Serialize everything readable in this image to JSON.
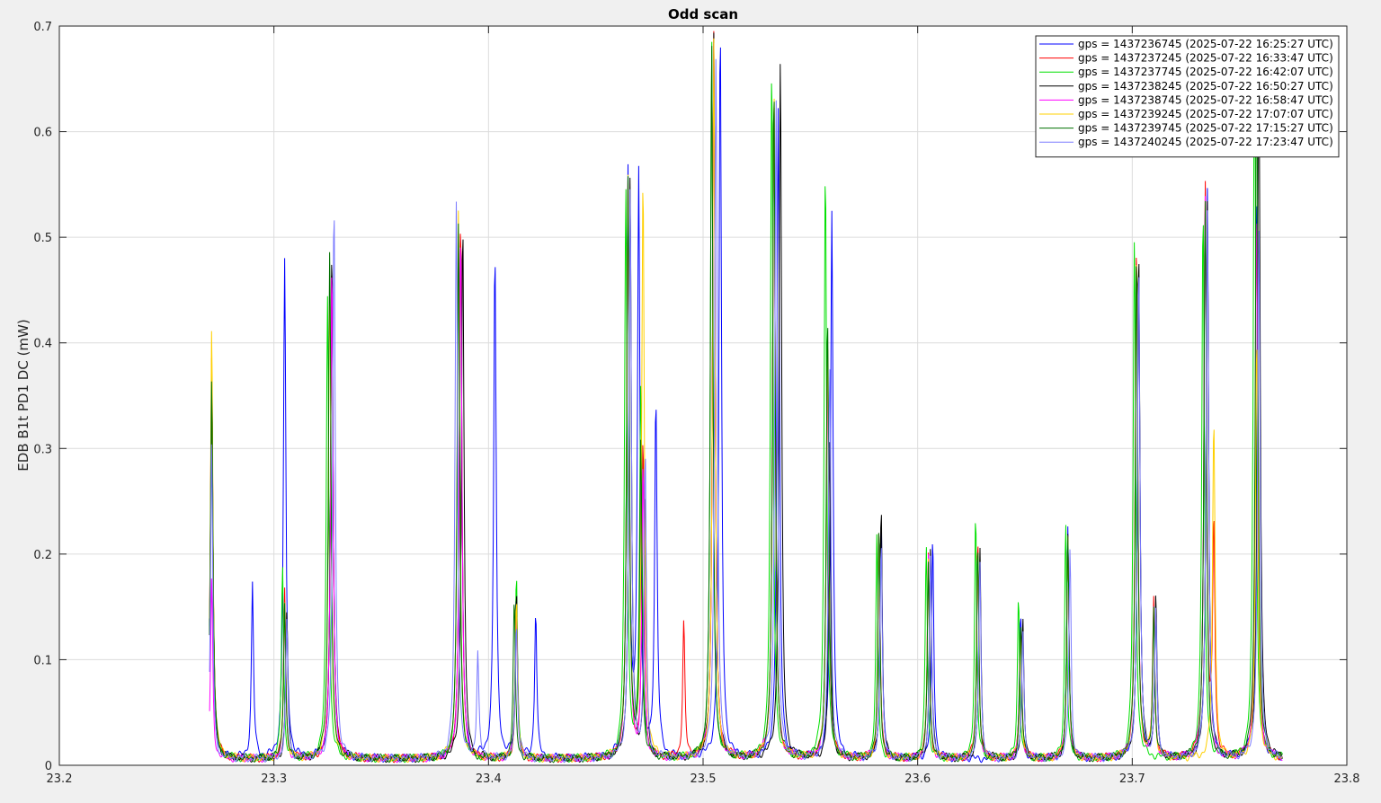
{
  "chart_data": {
    "type": "line",
    "title": "Odd scan",
    "xlabel": "",
    "ylabel": "EDB B1t PD1 DC (mW)",
    "xlim": [
      23.2,
      23.8
    ],
    "ylim": [
      0,
      0.7
    ],
    "xticks": [
      "23.2",
      "23.3",
      "23.4",
      "23.5",
      "23.6",
      "23.7",
      "23.8"
    ],
    "yticks": [
      "0",
      "0.1",
      "0.2",
      "0.3",
      "0.4",
      "0.5",
      "0.6",
      "0.7"
    ],
    "grid": true,
    "legend_position": "top-right",
    "baseline": 0.006,
    "x_range_of_data": [
      23.27,
      23.77
    ],
    "series": [
      {
        "name": "gps = 1437236745 (2025-07-22 16:25:27 UTC)",
        "color": "#0000ff",
        "shift": 0.001,
        "peaks": [
          [
            23.271,
            0.37
          ],
          [
            23.29,
            0.165
          ],
          [
            23.305,
            0.472
          ],
          [
            23.327,
            0.47
          ],
          [
            23.387,
            0.51
          ],
          [
            23.403,
            0.478
          ],
          [
            23.413,
            0.16
          ],
          [
            23.422,
            0.14
          ],
          [
            23.465,
            0.55
          ],
          [
            23.47,
            0.548
          ],
          [
            23.478,
            0.333
          ],
          [
            23.508,
            0.69
          ],
          [
            23.535,
            0.612
          ],
          [
            23.56,
            0.518
          ],
          [
            23.583,
            0.232
          ],
          [
            23.607,
            0.21
          ],
          [
            23.648,
            0.137
          ],
          [
            23.67,
            0.22
          ],
          [
            23.703,
            0.47
          ],
          [
            23.711,
            0.14
          ],
          [
            23.735,
            0.54
          ],
          [
            23.758,
            0.54
          ]
        ]
      },
      {
        "name": "gps = 1437237245 (2025-07-22 16:33:47 UTC)",
        "color": "#ff0000",
        "shift": 0.0,
        "peaks": [
          [
            23.271,
            0.385
          ],
          [
            23.305,
            0.16
          ],
          [
            23.327,
            0.472
          ],
          [
            23.387,
            0.51
          ],
          [
            23.413,
            0.14
          ],
          [
            23.465,
            0.55
          ],
          [
            23.472,
            0.3
          ],
          [
            23.491,
            0.127
          ],
          [
            23.505,
            0.685
          ],
          [
            23.533,
            0.635
          ],
          [
            23.558,
            0.39
          ],
          [
            23.582,
            0.22
          ],
          [
            23.605,
            0.195
          ],
          [
            23.628,
            0.21
          ],
          [
            23.648,
            0.13
          ],
          [
            23.67,
            0.215
          ],
          [
            23.702,
            0.485
          ],
          [
            23.71,
            0.148
          ],
          [
            23.734,
            0.545
          ],
          [
            23.738,
            0.22
          ],
          [
            23.758,
            0.52
          ]
        ]
      },
      {
        "name": "gps = 1437237745 (2025-07-22 16:42:07 UTC)",
        "color": "#00e000",
        "shift": -0.0005,
        "peaks": [
          [
            23.271,
            0.37
          ],
          [
            23.304,
            0.185
          ],
          [
            23.325,
            0.44
          ],
          [
            23.386,
            0.5
          ],
          [
            23.413,
            0.175
          ],
          [
            23.464,
            0.54
          ],
          [
            23.471,
            0.35
          ],
          [
            23.504,
            0.68
          ],
          [
            23.532,
            0.655
          ],
          [
            23.557,
            0.56
          ],
          [
            23.581,
            0.21
          ],
          [
            23.604,
            0.205
          ],
          [
            23.627,
            0.233
          ],
          [
            23.647,
            0.155
          ],
          [
            23.669,
            0.225
          ],
          [
            23.701,
            0.49
          ],
          [
            23.733,
            0.52
          ],
          [
            23.757,
            0.7
          ]
        ]
      },
      {
        "name": "gps = 1437238245 (2025-07-22 16:50:27 UTC)",
        "color": "#000000",
        "shift": 0.0015,
        "peaks": [
          [
            23.271,
            0.36
          ],
          [
            23.306,
            0.14
          ],
          [
            23.327,
            0.48
          ],
          [
            23.388,
            0.51
          ],
          [
            23.413,
            0.16
          ],
          [
            23.466,
            0.55
          ],
          [
            23.473,
            0.25
          ],
          [
            23.505,
            0.69
          ],
          [
            23.536,
            0.662
          ],
          [
            23.559,
            0.3
          ],
          [
            23.583,
            0.24
          ],
          [
            23.606,
            0.2
          ],
          [
            23.629,
            0.2
          ],
          [
            23.649,
            0.13
          ],
          [
            23.67,
            0.21
          ],
          [
            23.703,
            0.48
          ],
          [
            23.711,
            0.15
          ],
          [
            23.735,
            0.53
          ],
          [
            23.759,
            0.69
          ]
        ]
      },
      {
        "name": "gps = 1437238745 (2025-07-22 16:58:47 UTC)",
        "color": "#ff00ff",
        "shift": 0.0005,
        "peaks": [
          [
            23.271,
            0.17
          ],
          [
            23.305,
            0.14
          ],
          [
            23.327,
            0.47
          ],
          [
            23.387,
            0.5
          ],
          [
            23.413,
            0.14
          ],
          [
            23.465,
            0.54
          ],
          [
            23.472,
            0.28
          ],
          [
            23.505,
            0.68
          ],
          [
            23.533,
            0.63
          ],
          [
            23.558,
            0.38
          ],
          [
            23.582,
            0.21
          ],
          [
            23.605,
            0.19
          ],
          [
            23.628,
            0.2
          ],
          [
            23.648,
            0.12
          ],
          [
            23.67,
            0.21
          ],
          [
            23.702,
            0.48
          ],
          [
            23.71,
            0.14
          ],
          [
            23.734,
            0.54
          ],
          [
            23.758,
            0.52
          ]
        ]
      },
      {
        "name": "gps = 1437239245 (2025-07-22 17:07:07 UTC)",
        "color": "#ffd000",
        "shift": 0.0008,
        "peaks": [
          [
            23.271,
            0.408
          ],
          [
            23.305,
            0.15
          ],
          [
            23.326,
            0.45
          ],
          [
            23.386,
            0.52
          ],
          [
            23.413,
            0.15
          ],
          [
            23.465,
            0.545
          ],
          [
            23.472,
            0.548
          ],
          [
            23.505,
            0.68
          ],
          [
            23.533,
            0.64
          ],
          [
            23.558,
            0.4
          ],
          [
            23.582,
            0.21
          ],
          [
            23.605,
            0.19
          ],
          [
            23.628,
            0.2
          ],
          [
            23.648,
            0.12
          ],
          [
            23.67,
            0.21
          ],
          [
            23.702,
            0.48
          ],
          [
            23.71,
            0.14
          ],
          [
            23.738,
            0.32
          ],
          [
            23.758,
            0.4
          ]
        ]
      },
      {
        "name": "gps = 1437239745 (2025-07-22 17:15:27 UTC)",
        "color": "#007000",
        "shift": 0.0003,
        "peaks": [
          [
            23.271,
            0.36
          ],
          [
            23.305,
            0.15
          ],
          [
            23.326,
            0.486
          ],
          [
            23.386,
            0.51
          ],
          [
            23.412,
            0.15
          ],
          [
            23.465,
            0.55
          ],
          [
            23.471,
            0.3
          ],
          [
            23.504,
            0.68
          ],
          [
            23.533,
            0.64
          ],
          [
            23.558,
            0.42
          ],
          [
            23.582,
            0.22
          ],
          [
            23.605,
            0.19
          ],
          [
            23.628,
            0.2
          ],
          [
            23.648,
            0.13
          ],
          [
            23.67,
            0.21
          ],
          [
            23.702,
            0.48
          ],
          [
            23.71,
            0.14
          ],
          [
            23.734,
            0.53
          ],
          [
            23.758,
            0.68
          ]
        ]
      },
      {
        "name": "gps = 1437240245 (2025-07-22 17:23:47 UTC)",
        "color": "#7a7aff",
        "shift": 0.0015,
        "peaks": [
          [
            23.271,
            0.3
          ],
          [
            23.306,
            0.13
          ],
          [
            23.328,
            0.525
          ],
          [
            23.385,
            0.526
          ],
          [
            23.395,
            0.1
          ],
          [
            23.413,
            0.13
          ],
          [
            23.466,
            0.54
          ],
          [
            23.473,
            0.29
          ],
          [
            23.506,
            0.67
          ],
          [
            23.534,
            0.63
          ],
          [
            23.559,
            0.37
          ],
          [
            23.583,
            0.21
          ],
          [
            23.606,
            0.19
          ],
          [
            23.629,
            0.19
          ],
          [
            23.649,
            0.12
          ],
          [
            23.671,
            0.2
          ],
          [
            23.703,
            0.47
          ],
          [
            23.711,
            0.14
          ],
          [
            23.735,
            0.52
          ],
          [
            23.759,
            0.5
          ]
        ]
      }
    ]
  }
}
